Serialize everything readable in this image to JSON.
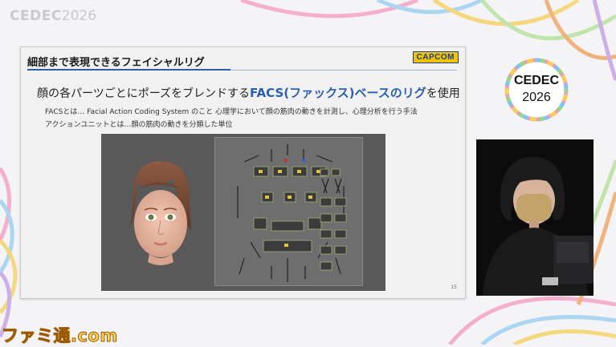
{
  "event": {
    "logo_brand": "CEDEC",
    "logo_year": "2026",
    "badge_brand": "CEDEC",
    "badge_year": "2026"
  },
  "slide": {
    "title": "細部まで表現できるフェイシャルリグ",
    "company_logo": "CAPCOM",
    "headline_before": "顔の各パーツごとにポーズをブレンドする",
    "headline_highlight": "FACS(ファックス)ベースのリグ",
    "headline_after": "を使用",
    "note1": "FACSとは…  Facial Action Coding System のこと  心理学において顔の筋肉の動きを計測し、心理分析を行う手法",
    "note2": "アクションユニットとは…顔の筋肉の動きを分類した単位",
    "page_number": "15"
  },
  "watermark": {
    "text": "ファミ通.com"
  },
  "colors": {
    "accent_blue": "#2a5fb0",
    "capcom_yellow": "#f2c300",
    "capcom_blue": "#1d3d8f"
  }
}
